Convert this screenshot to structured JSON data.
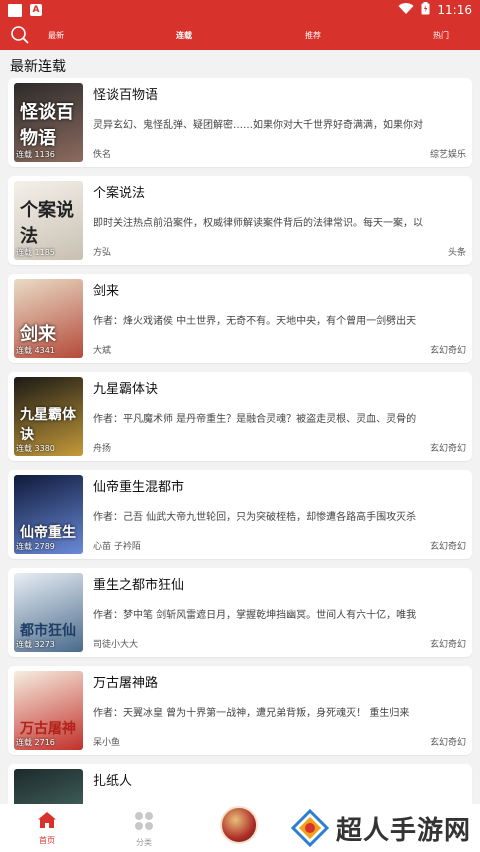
{
  "status": {
    "time": "11:16"
  },
  "nav": {
    "tabs": [
      {
        "label": "最新"
      },
      {
        "label": "连载"
      },
      {
        "label": "推荐"
      },
      {
        "label": "热门"
      }
    ]
  },
  "section_title": "最新连载",
  "books": [
    {
      "title": "怪谈百物语",
      "desc": "灵异玄幻、鬼怪乱弹、疑团解密……如果你对大千世界好奇满满，如果你对",
      "author": "佚名",
      "genre": "综艺娱乐",
      "count": "连载 1136",
      "cover_text": "怪谈百物语",
      "colors": [
        "#2b2b2b",
        "#8c6b5e"
      ]
    },
    {
      "title": "个案说法",
      "desc": "即时关注热点前沿案件，权威律师解读案件背后的法律常识。每天一案，以",
      "author": "方弘",
      "genre": "头条",
      "count": "连载 1185",
      "cover_text": "个案说法",
      "colors": [
        "#f4f0ea",
        "#c8c0b2"
      ]
    },
    {
      "title": "剑来",
      "desc": "作者：烽火戏诸侯 中土世界，无奇不有。天地中央，有个曾用一剑劈出天",
      "author": "大斌",
      "genre": "玄幻奇幻",
      "count": "连载 4341",
      "cover_text": "剑来",
      "colors": [
        "#e9dcc6",
        "#b54a3a"
      ]
    },
    {
      "title": "九星霸体诀",
      "desc": "作者：平凡魔术师 是丹帝重生？是融合灵魂？被盗走灵根、灵血、灵骨的",
      "author": "舟扬",
      "genre": "玄幻奇幻",
      "count": "连载 3380",
      "cover_text": "九星霸体诀",
      "colors": [
        "#1b1a16",
        "#c59a3a"
      ]
    },
    {
      "title": "仙帝重生混都市",
      "desc": "作者：己吾 仙武大帝九世轮回，只为突破桎梏，却惨遭各路高手围攻灭杀",
      "author": "心苗 子衿陌",
      "genre": "玄幻奇幻",
      "count": "连载 2789",
      "cover_text": "仙帝重生",
      "colors": [
        "#0f1a3a",
        "#6a8ad8"
      ]
    },
    {
      "title": "重生之都市狂仙",
      "desc": "作者：梦中笔 剑斩风雷遮日月，掌握乾坤挡幽冥。世间人有六十亿，唯我",
      "author": "司徒小大大",
      "genre": "玄幻奇幻",
      "count": "连载 3273",
      "cover_text": "都市狂仙",
      "colors": [
        "#e8eef4",
        "#4a6a8c"
      ]
    },
    {
      "title": "万古屠神路",
      "desc": "作者：天翼冰皇 曾为十界第一战神，遭兄弟背叛，身死魂灭！ 重生归来",
      "author": "呆小鱼",
      "genre": "玄幻奇幻",
      "count": "连载 2716",
      "cover_text": "万古屠神",
      "colors": [
        "#f6eee0",
        "#c2302a"
      ]
    },
    {
      "title": "扎纸人",
      "desc": "",
      "author": "",
      "genre": "",
      "count": "",
      "cover_text": "",
      "colors": [
        "#1c2a2a",
        "#3f5e5a"
      ]
    }
  ],
  "bottom_nav": {
    "home_label": "首页",
    "category_label": "分类",
    "brand": "超人手游网"
  },
  "theme": {
    "accent": "#d8322c"
  }
}
